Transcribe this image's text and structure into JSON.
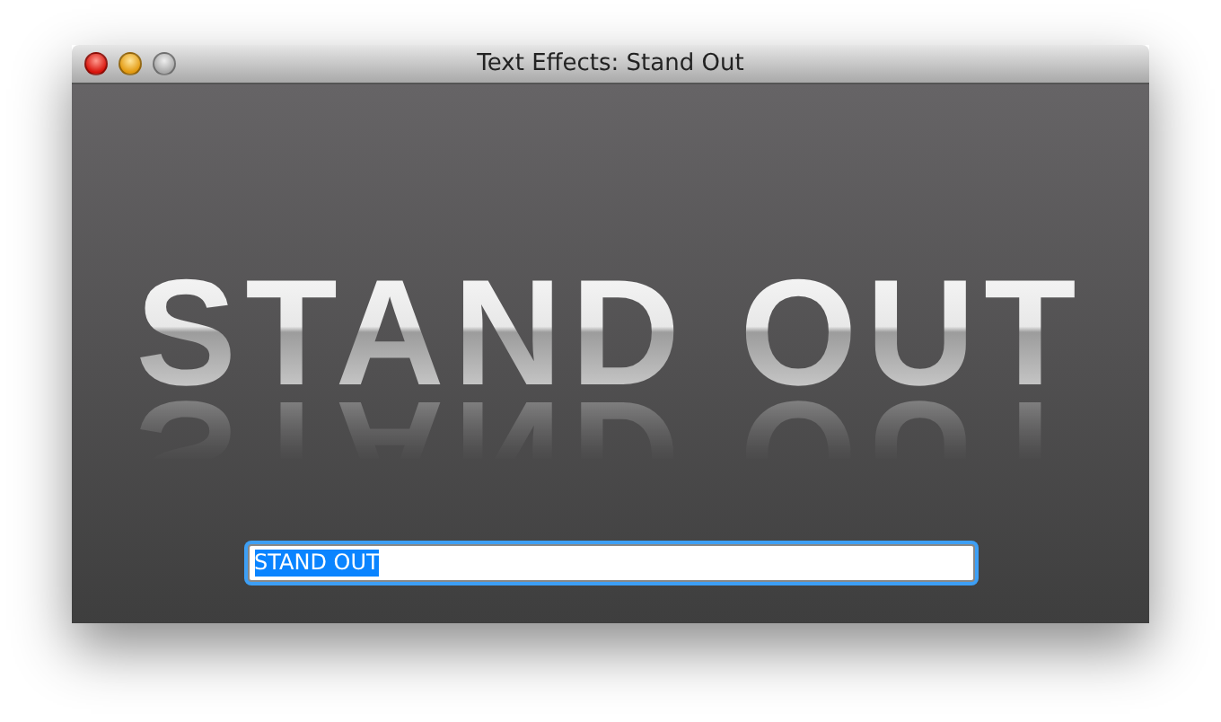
{
  "window": {
    "title": "Text Effects: Stand Out",
    "controls": [
      {
        "kind": "close",
        "disabled": false
      },
      {
        "kind": "minimize",
        "disabled": false
      },
      {
        "kind": "zoom",
        "disabled": true
      }
    ]
  },
  "headline": {
    "text": "STAND OUT"
  },
  "input": {
    "value": "STAND OUT",
    "selected": true,
    "focused": true
  }
}
